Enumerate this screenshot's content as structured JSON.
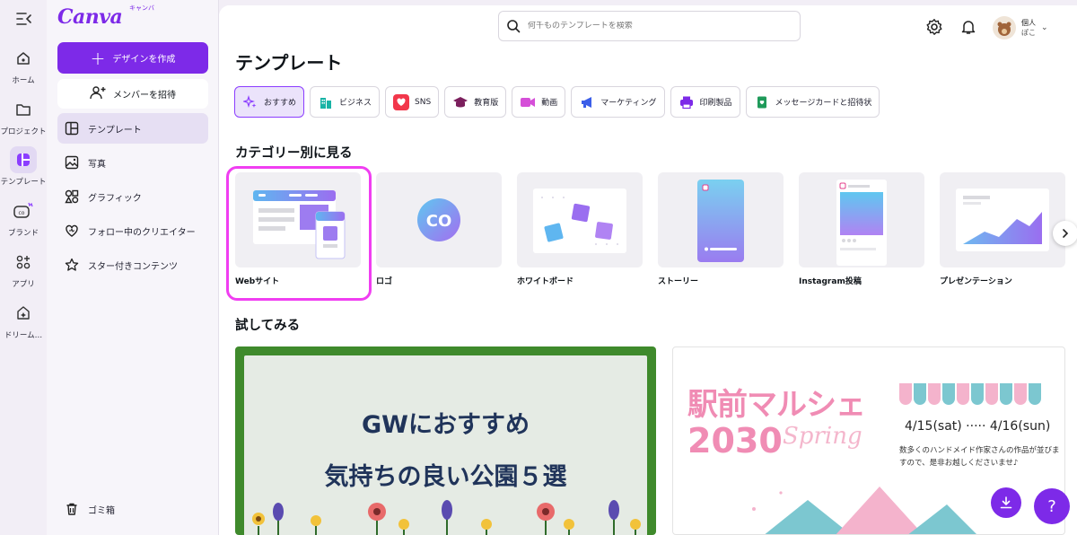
{
  "brand": {
    "logo": "Canva",
    "logo_sub": "キャンバ"
  },
  "rail": {
    "items": [
      {
        "label": "ホーム",
        "icon": "home-icon"
      },
      {
        "label": "プロジェクト",
        "icon": "folder-icon"
      },
      {
        "label": "テンプレート",
        "icon": "template-icon"
      },
      {
        "label": "ブランド",
        "icon": "brand-icon"
      },
      {
        "label": "アプリ",
        "icon": "apps-icon"
      },
      {
        "label": "ドリーム…",
        "icon": "dream-icon"
      }
    ]
  },
  "panel": {
    "create_label": "デザインを作成",
    "invite_label": "メンバーを招待",
    "nav": [
      {
        "label": "テンプレート",
        "icon": "template-icon"
      },
      {
        "label": "写真",
        "icon": "photo-icon"
      },
      {
        "label": "グラフィック",
        "icon": "graphics-icon"
      },
      {
        "label": "フォロー中のクリエイター",
        "icon": "heart-icon"
      },
      {
        "label": "スター付きコンテンツ",
        "icon": "star-icon"
      }
    ],
    "trash_label": "ゴミ箱"
  },
  "topbar": {
    "search_placeholder": "何千ものテンプレートを検索",
    "account_line1": "個人",
    "account_line2": "ぽこ"
  },
  "page": {
    "title": "テンプレート",
    "chips": [
      {
        "label": "おすすめ",
        "color": "#8b3dff"
      },
      {
        "label": "ビジネス",
        "color": "#18b3a5"
      },
      {
        "label": "SNS",
        "color": "#f2374b"
      },
      {
        "label": "教育版",
        "color": "#7b1f5d"
      },
      {
        "label": "動画",
        "color": "#d54fd8"
      },
      {
        "label": "マーケティング",
        "color": "#3b5ee8"
      },
      {
        "label": "印刷製品",
        "color": "#7d2ae8"
      },
      {
        "label": "メッセージカードと招待状",
        "color": "#1f9a5a"
      }
    ],
    "categories_title": "カテゴリー別に見る",
    "categories": [
      {
        "label": "Webサイト"
      },
      {
        "label": "ロゴ"
      },
      {
        "label": "ホワイトボード"
      },
      {
        "label": "ストーリー"
      },
      {
        "label": "Instagram投稿"
      },
      {
        "label": "プレゼンテーション"
      }
    ],
    "try_title": "試してみる",
    "card1": {
      "line1": "GWにおすすめ",
      "line2": "気持ちの良い公園５選"
    },
    "card2": {
      "title1": "駅前マルシェ",
      "title2": "2030",
      "spring": "Spring",
      "date": "4/15(sat) ····· 4/16(sun)",
      "desc": "数多くのハンドメイド作家さんの作品が並びますので、是非お越しくださいませ♪"
    },
    "logo_thumb_text": "CO",
    "help_label": "?"
  }
}
